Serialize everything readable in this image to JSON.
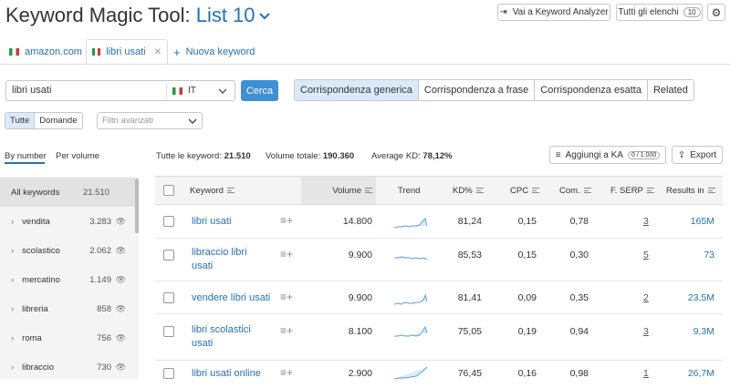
{
  "header": {
    "title": "Keyword Magic Tool:",
    "list_name": "List 10",
    "analyzer_button": "Vai a Keyword Analyzer",
    "lists_button": "Tutti gli elenchi",
    "lists_count": "10"
  },
  "tabs": [
    {
      "label": "amazon.com"
    },
    {
      "label": "libri usati"
    }
  ],
  "new_keyword": "Nuova keyword",
  "search": {
    "value": "libri usati",
    "country": "IT",
    "button": "Cerca"
  },
  "match_types": [
    "Corrispondenza generica",
    "Corrispondenza a frase",
    "Corrispondenza esatta",
    "Related"
  ],
  "filters": {
    "all": "Tutte",
    "questions": "Domande",
    "advanced_placeholder": "Filtri avanzati"
  },
  "group_by": {
    "number": "By number",
    "volume": "Per volume"
  },
  "summary": {
    "all_label": "Tutte le keyword:",
    "all_value": "21.510",
    "volume_label": "Volume totale:",
    "volume_value": "190.360",
    "kd_label": "Average KD:",
    "kd_value": "78,12%"
  },
  "actions": {
    "add_ka": "Aggiungi a KA",
    "add_ka_count": "0 / 1.000",
    "export": "Export"
  },
  "sidebar": {
    "all_label": "All keywords",
    "all_count": "21.510",
    "items": [
      {
        "label": "vendita",
        "count": "3.283"
      },
      {
        "label": "scolastico",
        "count": "2.062"
      },
      {
        "label": "mercatino",
        "count": "1.149"
      },
      {
        "label": "libreria",
        "count": "858"
      },
      {
        "label": "roma",
        "count": "756"
      },
      {
        "label": "libraccio",
        "count": "730"
      }
    ]
  },
  "columns": [
    "Keyword",
    "Volume",
    "Trend",
    "KD%",
    "CPC",
    "Com.",
    "F. SERP",
    "Results in"
  ],
  "rows": [
    {
      "keyword": "libri usati",
      "volume": "14.800",
      "kd": "81,24",
      "cpc": "0,15",
      "com": "0,78",
      "serp": "3",
      "results": "165M"
    },
    {
      "keyword": "libraccio libri usati",
      "volume": "9.900",
      "kd": "85,53",
      "cpc": "0,15",
      "com": "0,30",
      "serp": "5",
      "results": "73"
    },
    {
      "keyword": "vendere libri usati",
      "volume": "9.900",
      "kd": "81,41",
      "cpc": "0,09",
      "com": "0,35",
      "serp": "2",
      "results": "23,5M"
    },
    {
      "keyword": "libri scolastici usati",
      "volume": "8.100",
      "kd": "75,05",
      "cpc": "0,19",
      "com": "0,94",
      "serp": "3",
      "results": "9,3M"
    },
    {
      "keyword": "libri usati online",
      "volume": "2.900",
      "kd": "76,45",
      "cpc": "0,16",
      "com": "0,98",
      "serp": "1",
      "results": "26,7M"
    }
  ],
  "colors": {
    "accent": "#2372b9",
    "button": "#3d8fd6",
    "selected": "#dbeafa"
  }
}
